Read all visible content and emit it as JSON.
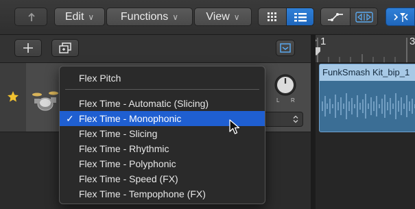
{
  "toolbar": {
    "back_icon": "back-arrow-icon",
    "edit_label": "Edit",
    "functions_label": "Functions",
    "view_label": "View",
    "chevron": "∨"
  },
  "track_controls": {
    "add_icon": "plus-icon",
    "duplicate_icon": "duplicate-track-icon",
    "pan_label_l": "L",
    "pan_label_r": "R"
  },
  "ruler": {
    "bar_1": "1",
    "bar_3": "3"
  },
  "region": {
    "name": "FunkSmash Kit_bip_1"
  },
  "popup_menu": {
    "header_item": "Flex Pitch",
    "items": [
      {
        "label": "Flex Time - Automatic (Slicing)",
        "selected": false
      },
      {
        "label": "Flex Time - Monophonic",
        "selected": true
      },
      {
        "label": "Flex Time - Slicing",
        "selected": false
      },
      {
        "label": "Flex Time - Rhythmic",
        "selected": false
      },
      {
        "label": "Flex Time - Polyphonic",
        "selected": false
      },
      {
        "label": "Flex Time - Speed (FX)",
        "selected": false
      },
      {
        "label": "Flex Time - Tempophone (FX)",
        "selected": false
      }
    ],
    "check_mark": "✓"
  },
  "colors": {
    "selection_blue": "#1f5fd1",
    "region_blue": "#3b6e95",
    "region_title": "#a7c9e6",
    "accent_blue": "#2f80d8",
    "favorite_star": "#f2c230"
  }
}
